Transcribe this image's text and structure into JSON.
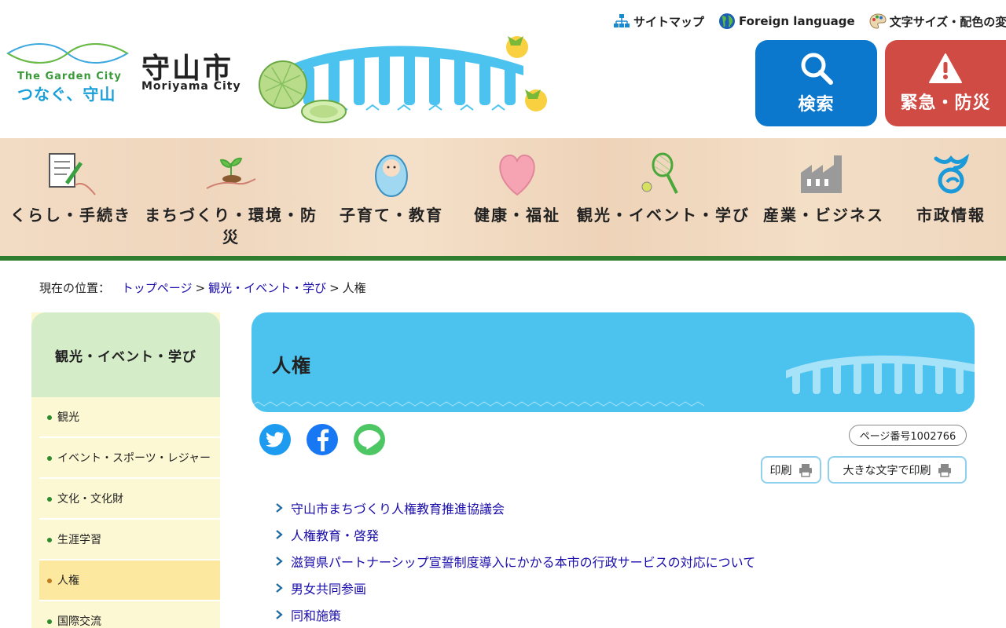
{
  "header": {
    "logo_top": "The Garden City",
    "logo_bottom": "つなぐ、守山",
    "city_name": "守山市",
    "city_name_en": "Moriyama City",
    "util_links": [
      {
        "label": "サイトマップ",
        "icon": "sitemap-icon"
      },
      {
        "label": "Foreign language",
        "icon": "globe-icon"
      },
      {
        "label": "文字サイズ・配色の変更",
        "icon": "palette-icon"
      }
    ],
    "search_label": "検索",
    "emergency_label": "緊急・防災",
    "colors": {
      "search": "#0b78cd",
      "emergency": "#cf4b43"
    }
  },
  "gnav": [
    {
      "label": "くらし・手続き",
      "icon": "document-pen-icon"
    },
    {
      "label": "まちづくり・環境・防災",
      "icon": "sprout-hand-icon"
    },
    {
      "label": "子育て・教育",
      "icon": "baby-icon"
    },
    {
      "label": "健康・福祉",
      "icon": "heart-icon"
    },
    {
      "label": "観光・イベント・学び",
      "icon": "tennis-racket-icon"
    },
    {
      "label": "産業・ビジネス",
      "icon": "factory-icon"
    },
    {
      "label": "市政情報",
      "icon": "city-emblem-icon"
    }
  ],
  "breadcrumb": {
    "prefix": "現在の位置：",
    "items": [
      "トップページ",
      "観光・イベント・学び",
      "人権"
    ]
  },
  "sidebar": {
    "heading": "観光・イベント・学び",
    "items": [
      {
        "label": "観光"
      },
      {
        "label": "イベント・スポーツ・レジャー"
      },
      {
        "label": "文化・文化財"
      },
      {
        "label": "生涯学習"
      },
      {
        "label": "人権",
        "current": true
      },
      {
        "label": "国際交流"
      }
    ]
  },
  "main": {
    "title": "人権",
    "page_number": "ページ番号1002766",
    "print_label": "印刷",
    "print_large_label": "大きな文字で印刷",
    "sns": [
      {
        "name": "twitter",
        "color": "#1d9bf0"
      },
      {
        "name": "facebook",
        "color": "#1877f2"
      },
      {
        "name": "line",
        "color": "#4cc764",
        "text": "LINE"
      }
    ],
    "links": [
      "守山市まちづくり人権教育推進協議会",
      "人権教育・啓発",
      "滋賀県パートナーシップ宣誓制度導入にかかる本市の行政サービスの対応について",
      "男女共同参画",
      "同和施策"
    ]
  }
}
